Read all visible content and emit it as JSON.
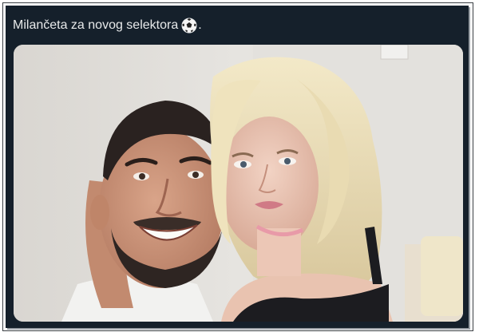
{
  "post": {
    "text": "Milančeta za novog selektora",
    "emoji_icon": "soccer-ball-icon",
    "trailing": "."
  },
  "media": {
    "alt": "Selfie of a smiling bearded man and a blonde woman"
  },
  "colors": {
    "background": "#15202b",
    "text": "#e7e9ea"
  }
}
